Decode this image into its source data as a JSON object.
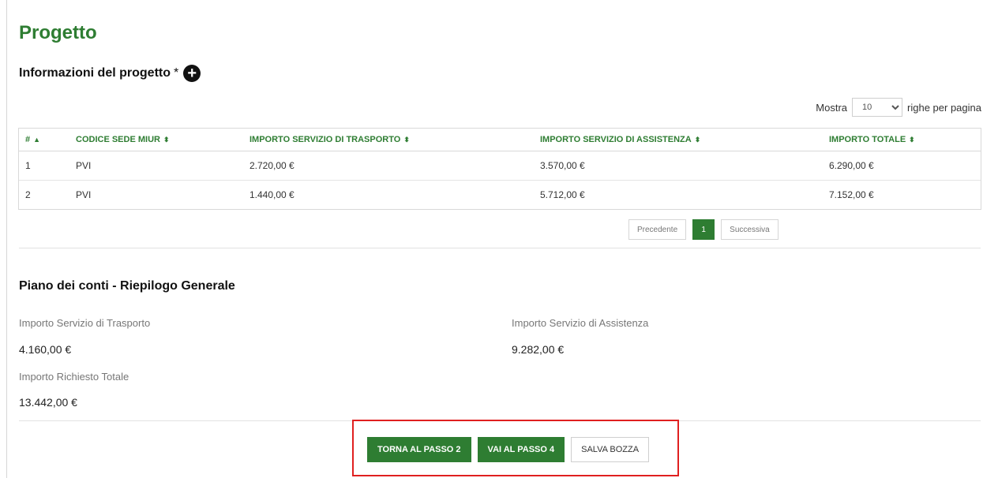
{
  "page": {
    "title": "Progetto"
  },
  "section": {
    "title": "Informazioni del progetto",
    "required_mark": "*"
  },
  "page_size": {
    "prefix": "Mostra",
    "selected": "10",
    "suffix": "righe per pagina"
  },
  "table": {
    "headers": [
      "#",
      "CODICE SEDE MIUR",
      "IMPORTO SERVIZIO DI TRASPORTO",
      "IMPORTO SERVIZIO DI ASSISTENZA",
      "IMPORTO TOTALE"
    ],
    "rows": [
      [
        "1",
        "PVI",
        "2.720,00 €",
        "3.570,00 €",
        "6.290,00 €"
      ],
      [
        "2",
        "PVI",
        "1.440,00 €",
        "5.712,00 €",
        "7.152,00 €"
      ]
    ]
  },
  "pager": {
    "prev": "Precedente",
    "current": "1",
    "next": "Successiva"
  },
  "summary": {
    "title": "Piano dei conti - Riepilogo Generale",
    "trasporto_label": "Importo Servizio di Trasporto",
    "trasporto_value": "4.160,00 €",
    "assistenza_label": "Importo Servizio di Assistenza",
    "assistenza_value": "9.282,00 €",
    "totale_label": "Importo Richiesto Totale",
    "totale_value": "13.442,00 €"
  },
  "actions": {
    "back": "TORNA AL PASSO 2",
    "next": "VAI AL PASSO 4",
    "save": "SALVA BOZZA"
  },
  "colors": {
    "accent": "#2e7d32",
    "highlight_border": "#e02020"
  },
  "icons": {
    "add": "plus-circle-icon",
    "sort": "sort-icon",
    "sort_asc": "chevron-up-icon"
  }
}
